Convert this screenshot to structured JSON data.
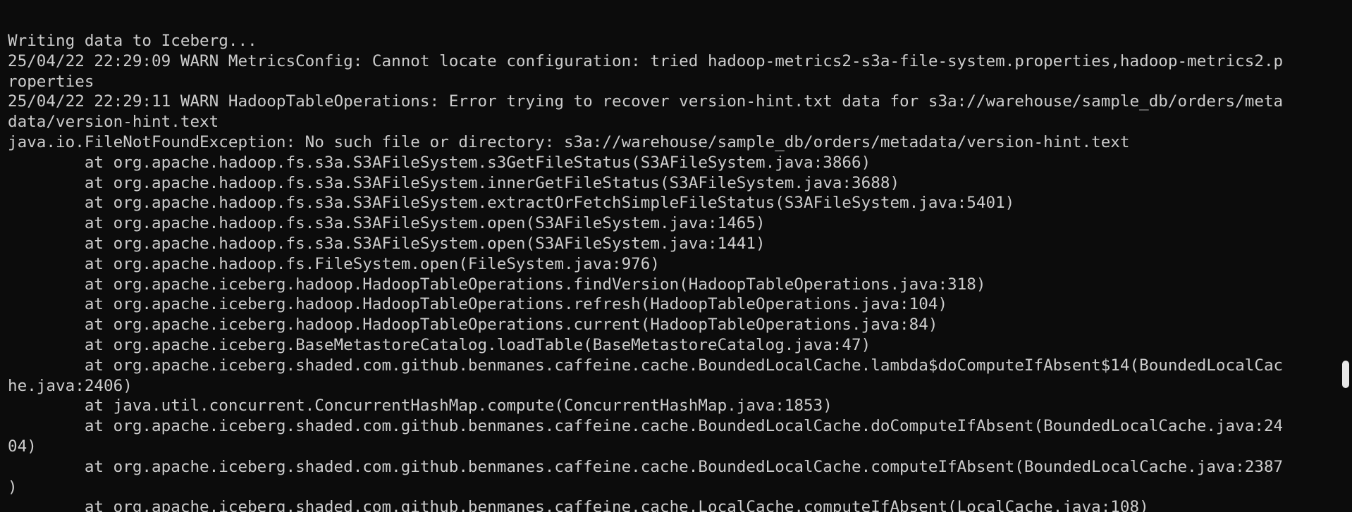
{
  "window": {
    "type": "terminal",
    "theme": {
      "background": "#0c0c0c",
      "foreground": "#cccccc",
      "scrollbar_thumb": "#e8e8e8"
    }
  },
  "terminal": {
    "lines": [
      "Writing data to Iceberg...",
      "25/04/22 22:29:09 WARN MetricsConfig: Cannot locate configuration: tried hadoop-metrics2-s3a-file-system.properties,hadoop-metrics2.p",
      "roperties",
      "25/04/22 22:29:11 WARN HadoopTableOperations: Error trying to recover version-hint.txt data for s3a://warehouse/sample_db/orders/meta",
      "data/version-hint.text",
      "java.io.FileNotFoundException: No such file or directory: s3a://warehouse/sample_db/orders/metadata/version-hint.text",
      "        at org.apache.hadoop.fs.s3a.S3AFileSystem.s3GetFileStatus(S3AFileSystem.java:3866)",
      "        at org.apache.hadoop.fs.s3a.S3AFileSystem.innerGetFileStatus(S3AFileSystem.java:3688)",
      "        at org.apache.hadoop.fs.s3a.S3AFileSystem.extractOrFetchSimpleFileStatus(S3AFileSystem.java:5401)",
      "        at org.apache.hadoop.fs.s3a.S3AFileSystem.open(S3AFileSystem.java:1465)",
      "        at org.apache.hadoop.fs.s3a.S3AFileSystem.open(S3AFileSystem.java:1441)",
      "        at org.apache.hadoop.fs.FileSystem.open(FileSystem.java:976)",
      "        at org.apache.iceberg.hadoop.HadoopTableOperations.findVersion(HadoopTableOperations.java:318)",
      "        at org.apache.iceberg.hadoop.HadoopTableOperations.refresh(HadoopTableOperations.java:104)",
      "        at org.apache.iceberg.hadoop.HadoopTableOperations.current(HadoopTableOperations.java:84)",
      "        at org.apache.iceberg.BaseMetastoreCatalog.loadTable(BaseMetastoreCatalog.java:47)",
      "        at org.apache.iceberg.shaded.com.github.benmanes.caffeine.cache.BoundedLocalCache.lambda$doComputeIfAbsent$14(BoundedLocalCac",
      "he.java:2406)",
      "        at java.util.concurrent.ConcurrentHashMap.compute(ConcurrentHashMap.java:1853)",
      "        at org.apache.iceberg.shaded.com.github.benmanes.caffeine.cache.BoundedLocalCache.doComputeIfAbsent(BoundedLocalCache.java:24",
      "04)",
      "        at org.apache.iceberg.shaded.com.github.benmanes.caffeine.cache.BoundedLocalCache.computeIfAbsent(BoundedLocalCache.java:2387",
      ")",
      "        at org.apache.iceberg.shaded.com.github.benmanes.caffeine.cache.LocalCache.computeIfAbsent(LocalCache.java:108)"
    ]
  }
}
